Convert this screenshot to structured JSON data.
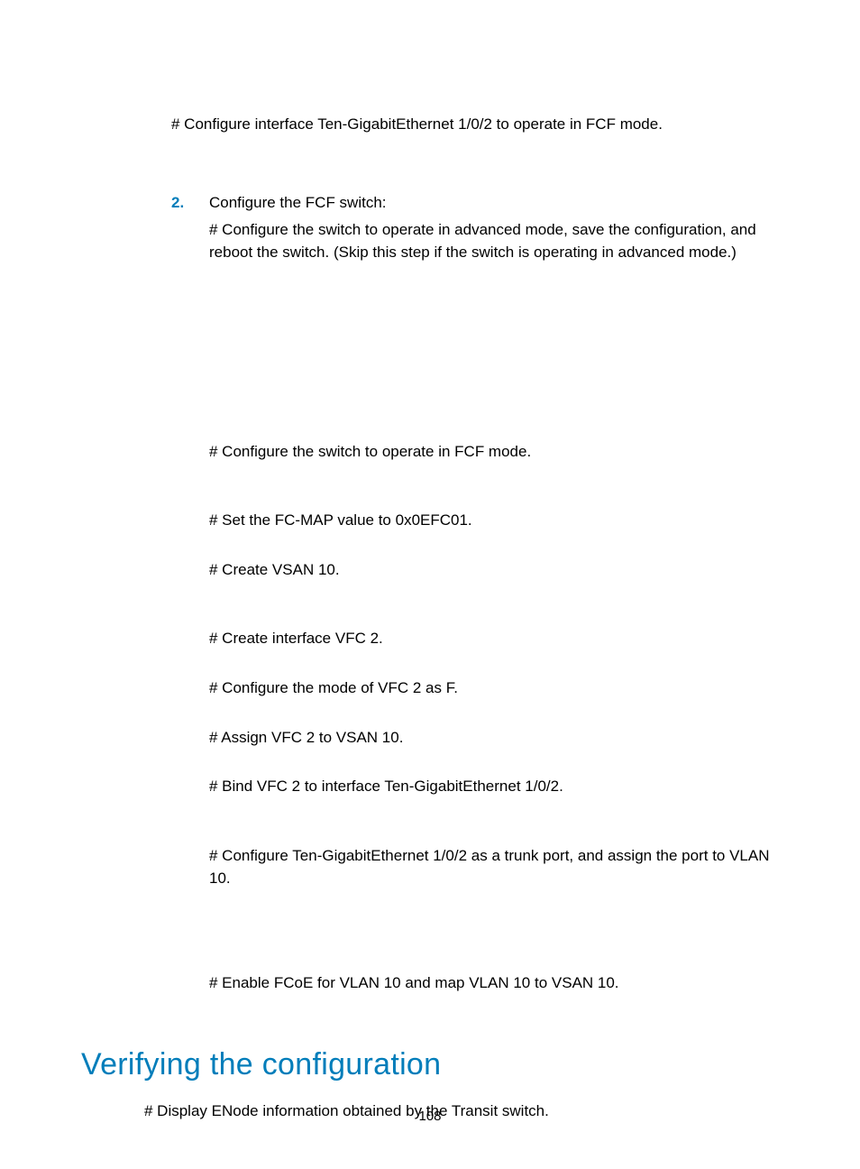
{
  "top_hash": "# Configure interface Ten-GigabitEthernet 1/0/2 to operate in FCF mode.",
  "step": {
    "number": "2.",
    "title": "Configure the FCF switch:",
    "intro": "# Configure the switch to operate in advanced mode, save the configuration, and reboot the switch. (Skip this step if the switch is operating in advanced mode.)",
    "items": [
      "# Configure the switch to operate in FCF mode.",
      "# Set the FC-MAP value to 0x0EFC01.",
      "# Create VSAN 10.",
      "# Create interface VFC 2.",
      "# Configure the mode of VFC 2 as F.",
      "# Assign VFC 2 to VSAN 10.",
      "# Bind VFC 2 to interface Ten-GigabitEthernet 1/0/2.",
      "# Configure Ten-GigabitEthernet 1/0/2 as a trunk port, and assign the port to VLAN 10.",
      "# Enable FCoE for VLAN 10 and map VLAN 10 to VSAN 10."
    ]
  },
  "section_heading": "Verifying the configuration",
  "section_body": "# Display ENode information obtained by the Transit switch.",
  "page_number": "108"
}
